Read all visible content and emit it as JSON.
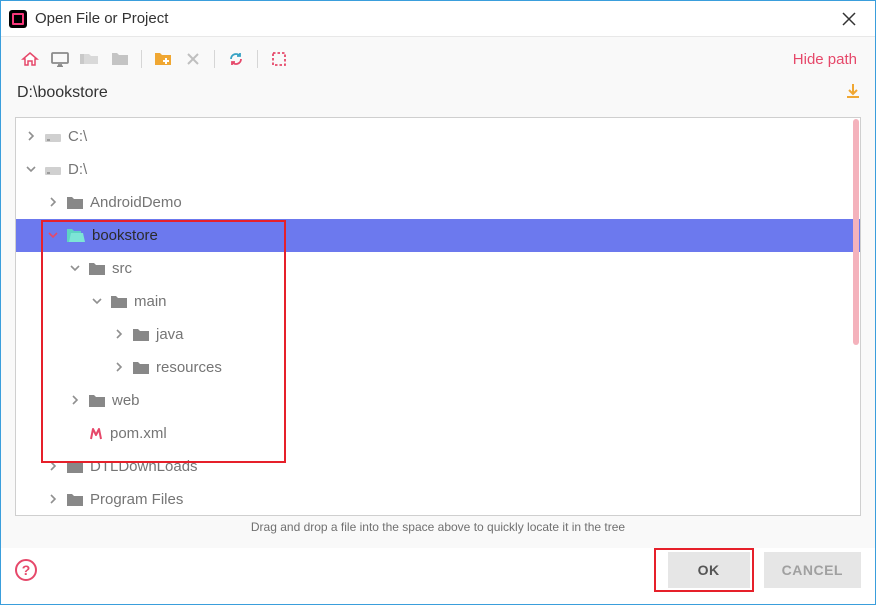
{
  "dialog": {
    "title": "Open File or Project"
  },
  "toolbar": {
    "hide_path": "Hide path"
  },
  "path": {
    "value": "D:\\bookstore"
  },
  "tree": {
    "rows": [
      {
        "indent": 0,
        "expander": "right",
        "icon": "drive",
        "label": "C:\\"
      },
      {
        "indent": 0,
        "expander": "down",
        "icon": "drive",
        "label": "D:\\"
      },
      {
        "indent": 1,
        "expander": "right",
        "icon": "folder",
        "label": "AndroidDemo"
      },
      {
        "indent": 1,
        "expander": "down",
        "icon": "folder-open-green",
        "label": "bookstore",
        "selected": true
      },
      {
        "indent": 2,
        "expander": "down",
        "icon": "folder",
        "label": "src"
      },
      {
        "indent": 3,
        "expander": "down",
        "icon": "folder",
        "label": "main"
      },
      {
        "indent": 4,
        "expander": "right",
        "icon": "folder",
        "label": "java"
      },
      {
        "indent": 4,
        "expander": "right",
        "icon": "folder",
        "label": "resources"
      },
      {
        "indent": 2,
        "expander": "right",
        "icon": "folder",
        "label": "web"
      },
      {
        "indent": 2,
        "expander": "none",
        "icon": "maven",
        "label": "pom.xml"
      },
      {
        "indent": 1,
        "expander": "right",
        "icon": "folder",
        "label": "DTLDownLoads"
      },
      {
        "indent": 1,
        "expander": "right",
        "icon": "folder",
        "label": "Program Files"
      }
    ]
  },
  "footer": {
    "hint": "Drag and drop a file into the space above to quickly locate it in the tree",
    "ok": "OK",
    "cancel": "CANCEL",
    "help": "?"
  }
}
